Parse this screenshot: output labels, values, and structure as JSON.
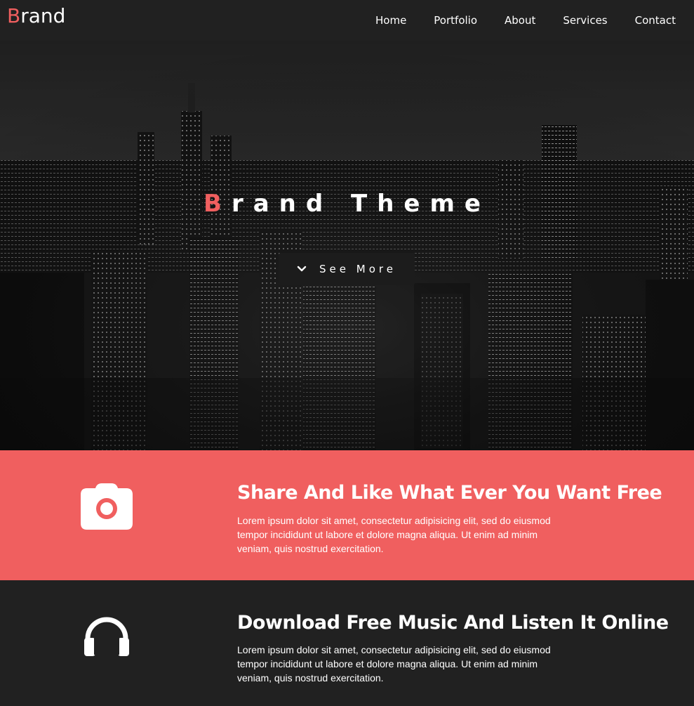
{
  "navbar": {
    "brand_initial": "B",
    "brand_rest": "rand",
    "links": [
      {
        "label": "Home"
      },
      {
        "label": "Portfolio"
      },
      {
        "label": "About"
      },
      {
        "label": "Services"
      },
      {
        "label": "Contact"
      }
    ]
  },
  "hero": {
    "title_initial": "B",
    "title_rest": "rand Theme",
    "button_label": "See More",
    "button_icon": "chevron-down-icon"
  },
  "features": [
    {
      "icon": "camera-icon",
      "title": "Share And Like What Ever You Want Free",
      "text": "Lorem ipsum dolor sit amet, consectetur adipisicing elit, sed do eiusmod tempor incididunt ut labore et dolore magna aliqua. Ut enim ad minim veniam, quis nostrud exercitation."
    },
    {
      "icon": "headphones-icon",
      "title": "Download Free Music And Listen It Online",
      "text": "Lorem ipsum dolor sit amet, consectetur adipisicing elit, sed do eiusmod tempor incididunt ut labore et dolore magna aliqua. Ut enim ad minim veniam, quis nostrud exercitation."
    }
  ],
  "colors": {
    "accent": "#f05f5f",
    "dark": "#212121"
  }
}
